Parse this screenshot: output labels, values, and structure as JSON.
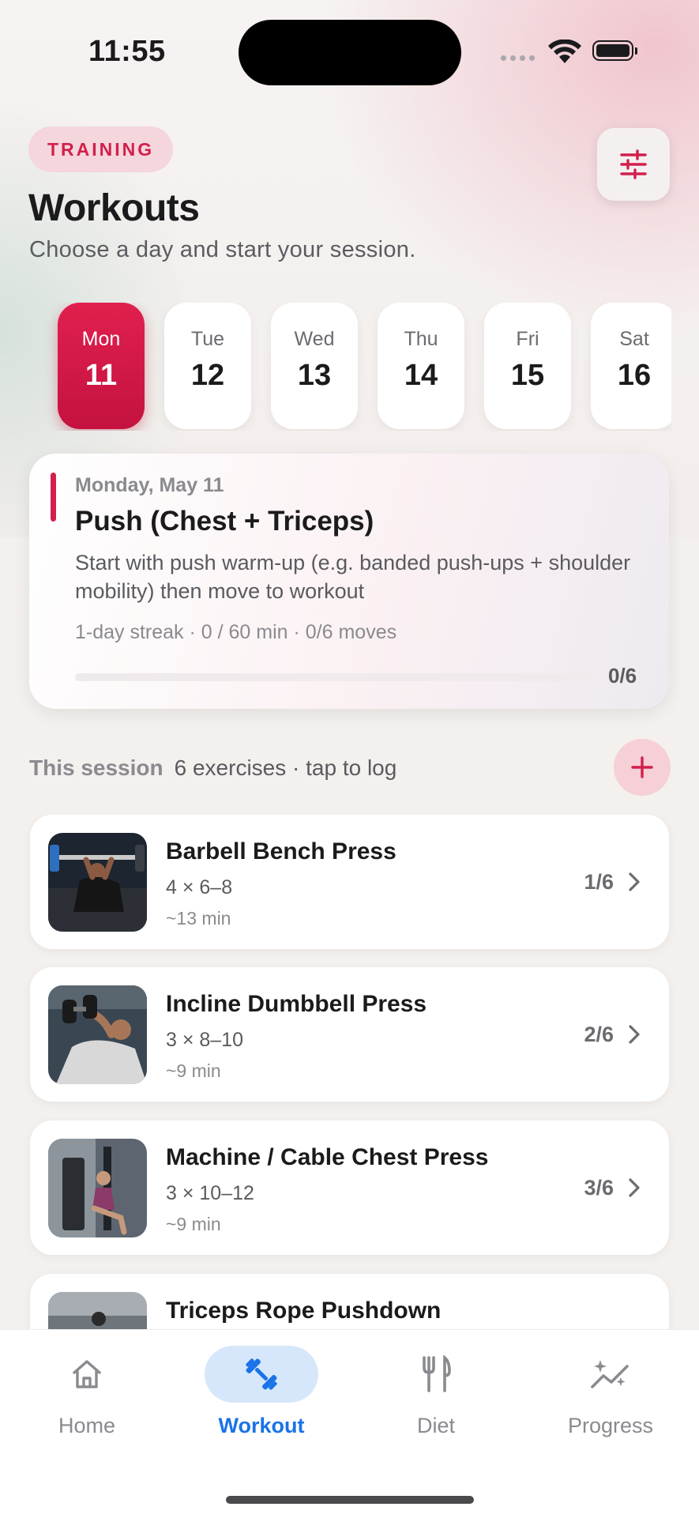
{
  "status": {
    "time": "11:55"
  },
  "header": {
    "badge": "TRAINING",
    "title": "Workouts",
    "subtitle": "Choose a day and start your session."
  },
  "days": [
    {
      "name": "Mon",
      "num": "11",
      "selected": true
    },
    {
      "name": "Tue",
      "num": "12",
      "selected": false
    },
    {
      "name": "Wed",
      "num": "13",
      "selected": false
    },
    {
      "name": "Thu",
      "num": "14",
      "selected": false
    },
    {
      "name": "Fri",
      "num": "15",
      "selected": false
    },
    {
      "name": "Sat",
      "num": "16",
      "selected": false
    }
  ],
  "session_card": {
    "date": "Monday, May 11",
    "name": "Push (Chest + Triceps)",
    "description": "Start with push warm-up (e.g. banded push-ups + shoulder mobility) then move to workout",
    "meta": "1-day streak · 0 / 60 min · 0/6 moves",
    "progress_count": "0/6",
    "progress_fraction": 0
  },
  "section": {
    "heading": "This session",
    "summary": "6 exercises · tap to log"
  },
  "exercises": [
    {
      "name": "Barbell Bench Press",
      "sets": "4 × 6–8",
      "time": "~13 min",
      "count": "1/6"
    },
    {
      "name": "Incline Dumbbell Press",
      "sets": "3 × 8–10",
      "time": "~9 min",
      "count": "2/6"
    },
    {
      "name": "Machine / Cable Chest Press",
      "sets": "3 × 10–12",
      "time": "~9 min",
      "count": "3/6"
    },
    {
      "name": "Triceps Rope Pushdown",
      "sets": "",
      "time": "",
      "count": ""
    }
  ],
  "tabs": [
    {
      "label": "Home",
      "icon": "home-icon",
      "active": false
    },
    {
      "label": "Workout",
      "icon": "dumbbell-icon",
      "active": true
    },
    {
      "label": "Diet",
      "icon": "fork-knife-icon",
      "active": false
    },
    {
      "label": "Progress",
      "icon": "sparkle-chart-icon",
      "active": false
    }
  ],
  "colors": {
    "accent": "#d2204c",
    "tab_active": "#1a73e8",
    "tab_active_bg": "#d7e7fb"
  }
}
